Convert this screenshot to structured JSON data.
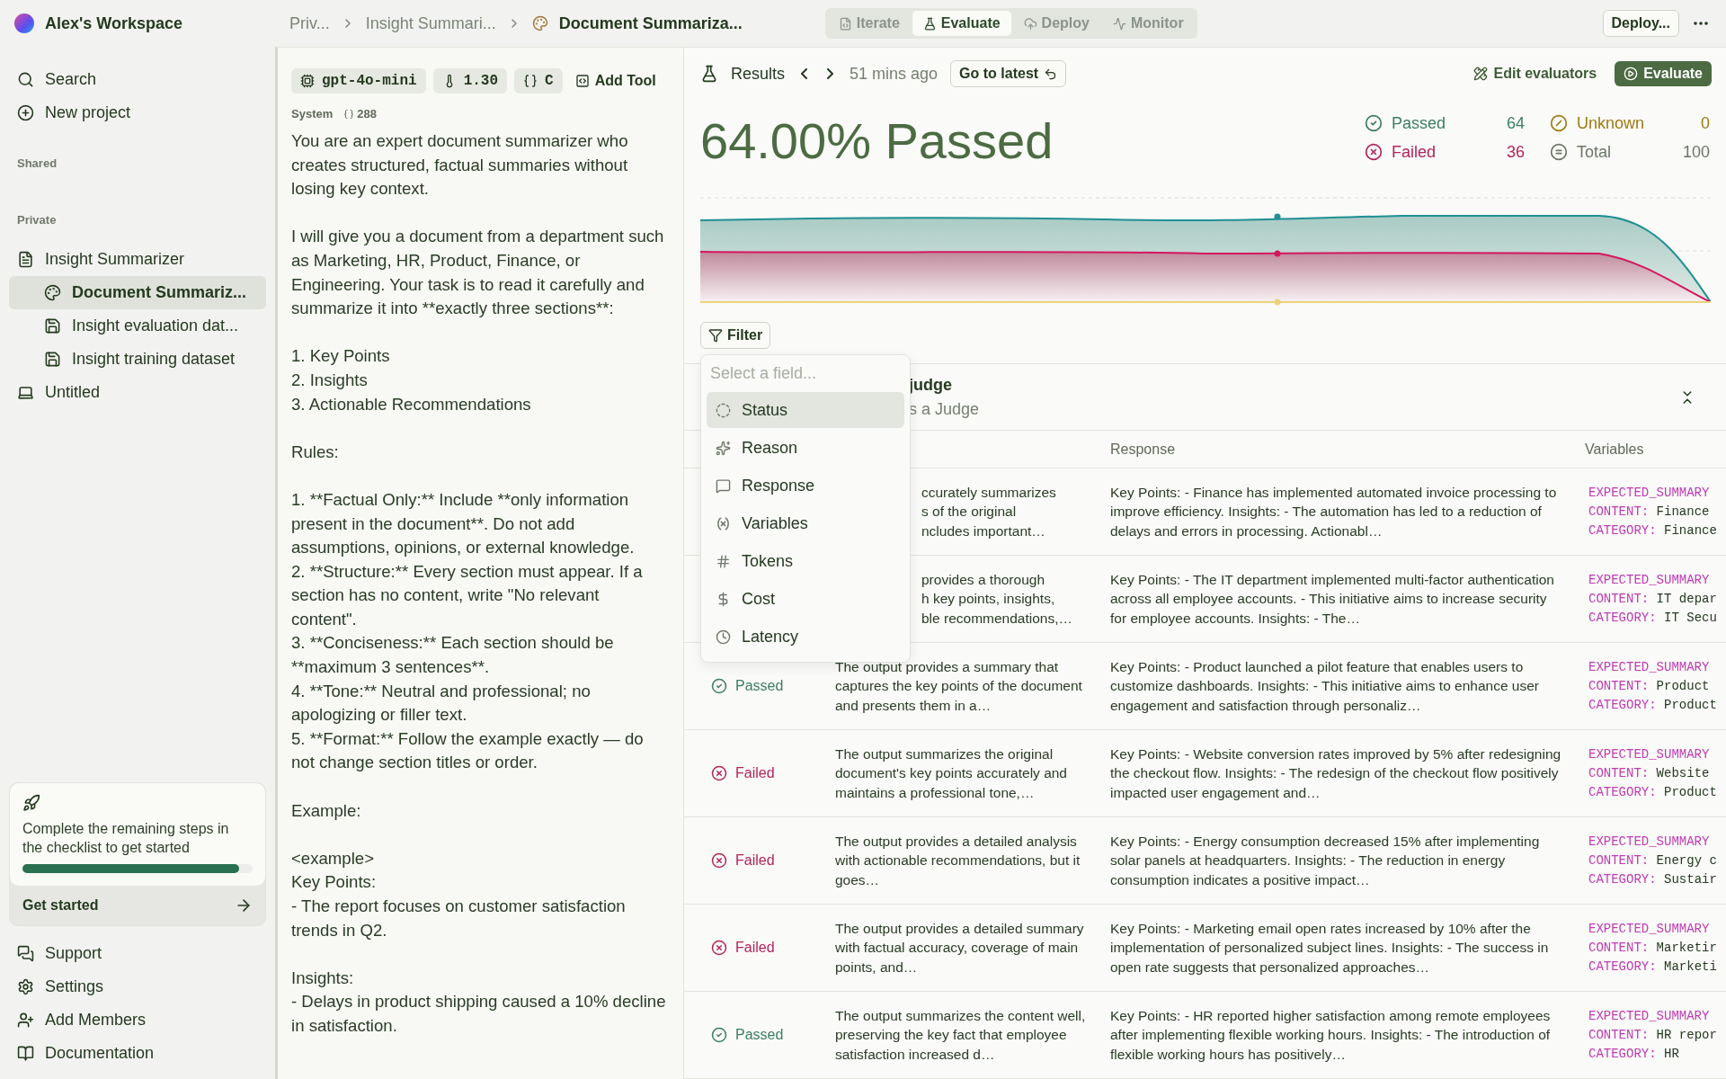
{
  "workspace": {
    "name": "Alex's Workspace"
  },
  "breadcrumb": [
    {
      "label": "Priv..."
    },
    {
      "label": "Insight Summari..."
    },
    {
      "label": "Document Summariza...",
      "current": true
    }
  ],
  "mode_tabs": [
    {
      "label": "Iterate",
      "kind": "iterate",
      "selected": false
    },
    {
      "label": "Evaluate",
      "kind": "evaluate",
      "selected": true
    },
    {
      "label": "Deploy",
      "kind": "deploy",
      "selected": false
    },
    {
      "label": "Monitor",
      "kind": "monitor",
      "selected": false
    }
  ],
  "deploy_button": "Deploy...",
  "sidebar": {
    "top_items": [
      {
        "label": "Search",
        "kind": "search"
      },
      {
        "label": "New project",
        "kind": "new"
      }
    ],
    "sections": [
      {
        "title": "Shared"
      },
      {
        "title": "Private",
        "items": [
          {
            "label": "Insight Summarizer",
            "kind": "notes",
            "selected": false,
            "children": [
              {
                "label": "Document Summariz...",
                "kind": "palette",
                "selected": true
              },
              {
                "label": "Insight evaluation dat...",
                "kind": "dataset",
                "selected": false
              },
              {
                "label": "Insight training dataset",
                "kind": "dataset",
                "selected": false
              }
            ]
          },
          {
            "label": "Untitled",
            "kind": "laptop",
            "selected": false
          }
        ]
      }
    ],
    "checklist": {
      "text": "Complete the remaining steps in the checklist to get started",
      "level": 0.94,
      "action": "Get started"
    },
    "bottom_items": [
      {
        "label": "Support",
        "kind": "support"
      },
      {
        "label": "Settings",
        "kind": "settings"
      },
      {
        "label": "Add Members",
        "kind": "members"
      },
      {
        "label": "Documentation",
        "kind": "docs"
      }
    ]
  },
  "prompt": {
    "chips": [
      {
        "label": "gpt-4o-mini",
        "kind": "model"
      },
      {
        "label": "1.30",
        "kind": "temperature"
      },
      {
        "label": "C",
        "kind": "format"
      }
    ],
    "add_tool": "Add Tool",
    "role": "System",
    "token_count": "288",
    "text": "You are an expert document summarizer who creates structured, factual summaries without losing key context.\n\nI will give you a document from a department such as Marketing, HR, Product, Finance, or Engineering. Your task is to read it carefully and summarize it into **exactly three sections**:\n\n1. Key Points\n2. Insights\n3. Actionable Recommendations\n\nRules:\n\n1. **Factual Only:** Include **only information present in the document**. Do not add assumptions, opinions, or external knowledge.\n2. **Structure:** Every section must appear. If a section has no content, write \"No relevant content\".\n3. **Conciseness:** Each section should be **maximum 3 sentences**.\n4. **Tone:** Neutral and professional; no apologizing or filler text.\n5. **Format:** Follow the example exactly — do not change section titles or order.\n\nExample:\n\n<example>\nKey Points:\n- The report focuses on customer satisfaction trends in Q2.\n\nInsights:\n- Delays in product shipping caused a 10% decline in satisfaction."
  },
  "results": {
    "title": "Results",
    "time": "51 mins ago",
    "latest_button": "Go to latest",
    "edit_button": "Edit evaluators",
    "evaluate_button": "Evaluate",
    "headline": "64.00% Passed",
    "stats": [
      {
        "label": "Passed",
        "value": "64",
        "kind": "passed"
      },
      {
        "label": "Unknown",
        "value": "0",
        "kind": "unknown"
      },
      {
        "label": "Failed",
        "value": "36",
        "kind": "failed"
      },
      {
        "label": "Total",
        "value": "100",
        "kind": "total"
      }
    ],
    "filter_button": "Filter",
    "filter_menu": {
      "placeholder": "Select a field...",
      "items": [
        {
          "label": "Status",
          "kind": "status",
          "selected": true
        },
        {
          "label": "Reason",
          "kind": "reason",
          "selected": false
        },
        {
          "label": "Response",
          "kind": "response",
          "selected": false
        },
        {
          "label": "Variables",
          "kind": "variables",
          "selected": false
        },
        {
          "label": "Tokens",
          "kind": "tokens",
          "selected": false
        },
        {
          "label": "Cost",
          "kind": "cost",
          "selected": false
        },
        {
          "label": "Latency",
          "kind": "latency",
          "selected": false
        }
      ]
    },
    "evaluator": {
      "name": "judge",
      "subtitle": "s a Judge"
    },
    "columns": [
      "Response",
      "Variables"
    ],
    "rows": [
      {
        "reason": "ccurately summarizes\ns of the original\nncludes important…",
        "response": "Key Points: - Finance has implemented automated invoice processing to improve efficiency. Insights: - The automation has led to a reduction of delays and errors in processing. Actionabl…",
        "variables": [
          {
            "key": "EXPECTED_SUMMARY"
          },
          {
            "key": "CONTENT:",
            "value": "Finance"
          },
          {
            "key": "CATEGORY:",
            "value": "Finance"
          }
        ]
      },
      {
        "reason": "provides a thorough\nh key points, insights,\nble recommendations,…",
        "response": "Key Points: - The IT department implemented multi-factor authentication across all employee accounts. - This initiative aims to increase security for employee accounts. Insights: - The…",
        "variables": [
          {
            "key": "EXPECTED_SUMMARY"
          },
          {
            "key": "CONTENT:",
            "value": "IT depar"
          },
          {
            "key": "CATEGORY:",
            "value": "IT Secu"
          }
        ]
      },
      {
        "status": {
          "label": "Passed",
          "kind": "passed"
        },
        "reason": "The output provides a summary that captures the key points of the document and presents them in a…",
        "response": "Key Points: - Product launched a pilot feature that enables users to customize dashboards. Insights: - This initiative aims to enhance user engagement and satisfaction through personaliz…",
        "variables": [
          {
            "key": "EXPECTED_SUMMARY"
          },
          {
            "key": "CONTENT:",
            "value": "Product"
          },
          {
            "key": "CATEGORY:",
            "value": "Product"
          }
        ]
      },
      {
        "status": {
          "label": "Failed",
          "kind": "failed"
        },
        "reason": "The output summarizes the original document's key points accurately and maintains a professional tone,…",
        "response": "Key Points: - Website conversion rates improved by 5% after redesigning the checkout flow. Insights: - The redesign of the checkout flow positively impacted user engagement and…",
        "variables": [
          {
            "key": "EXPECTED_SUMMARY"
          },
          {
            "key": "CONTENT:",
            "value": "Website"
          },
          {
            "key": "CATEGORY:",
            "value": "Product"
          }
        ]
      },
      {
        "status": {
          "label": "Failed",
          "kind": "failed"
        },
        "reason": "The output provides a detailed analysis with actionable recommendations, but it goes…",
        "response": "Key Points: - Energy consumption decreased 15% after implementing solar panels at headquarters. Insights: - The reduction in energy consumption indicates a positive impact…",
        "variables": [
          {
            "key": "EXPECTED_SUMMARY"
          },
          {
            "key": "CONTENT:",
            "value": "Energy c"
          },
          {
            "key": "CATEGORY:",
            "value": "Sustair"
          }
        ]
      },
      {
        "status": {
          "label": "Failed",
          "kind": "failed"
        },
        "reason": "The output provides a detailed summary with factual accuracy, coverage of main points, and…",
        "response": "Key Points: - Marketing email open rates increased by 10% after the implementation of personalized subject lines. Insights: - The success in open rate suggests that personalized approaches…",
        "variables": [
          {
            "key": "EXPECTED_SUMMARY"
          },
          {
            "key": "CONTENT:",
            "value": "Marketir"
          },
          {
            "key": "CATEGORY:",
            "value": "Marketi"
          }
        ]
      },
      {
        "status": {
          "label": "Passed",
          "kind": "passed"
        },
        "reason": "The output summarizes the content well, preserving the key fact that employee satisfaction increased d…",
        "response": "Key Points: - HR reported higher satisfaction among remote employees after implementing flexible working hours. Insights: - The introduction of flexible working hours has positively…",
        "variables": [
          {
            "key": "EXPECTED_SUMMARY"
          },
          {
            "key": "CONTENT:",
            "value": "HR repor"
          },
          {
            "key": "CATEGORY:",
            "value": "HR"
          }
        ]
      }
    ]
  }
}
